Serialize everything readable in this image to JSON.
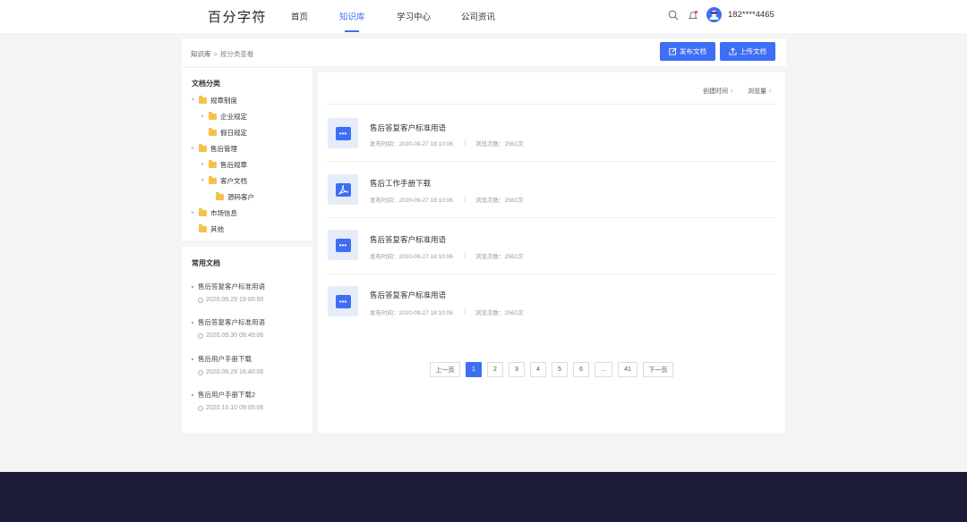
{
  "header": {
    "logo": "百分字符",
    "nav": [
      "首页",
      "知识库",
      "学习中心",
      "公司资讯"
    ],
    "phone": "182****4465"
  },
  "breadcrumb": {
    "root": "知识库",
    "sep": ">",
    "current": "按分类查看"
  },
  "actions": {
    "publish": "发布文档",
    "upload": "上传文档"
  },
  "categories": {
    "title": "文档分类",
    "items": [
      {
        "label": "规章制度"
      },
      {
        "label": "企业规定"
      },
      {
        "label": "假日规定"
      },
      {
        "label": "售后管理"
      },
      {
        "label": "售后规章"
      },
      {
        "label": "客户文档"
      },
      {
        "label": "源码客户"
      },
      {
        "label": "市场信息"
      },
      {
        "label": "其他"
      }
    ]
  },
  "common": {
    "title": "常用文档",
    "items": [
      {
        "title": "售后答复客户标准用语",
        "date": "2020.09.29 19:00:50"
      },
      {
        "title": "售后答复客户标准用语",
        "date": "2020.09.30 09:45:06"
      },
      {
        "title": "售后用户手册下载",
        "date": "2020.09.29 16:40:06"
      },
      {
        "title": "售后用户手册下载2",
        "date": "2020.10.10 09:05:06"
      }
    ]
  },
  "sort": {
    "created": "创建时间",
    "views": "浏览量"
  },
  "docs": [
    {
      "icon": "message-icon",
      "title": "售后答复客户标准用语",
      "published": "发布时间：2020-09-27 18:10:06",
      "views": "浏览次数：2562次"
    },
    {
      "icon": "pdf-icon",
      "title": "售后工作手册下载",
      "published": "发布时间：2020-09-27 18:10:06",
      "views": "浏览次数：2562次"
    },
    {
      "icon": "message-icon",
      "title": "售后答复客户标准用语",
      "published": "发布时间：2020-09-27 18:10:06",
      "views": "浏览次数：2562次"
    },
    {
      "icon": "message-icon",
      "title": "售后答复客户标准用语",
      "published": "发布时间：2020-09-27 18:10:06",
      "views": "浏览次数：2562次"
    }
  ],
  "pagination": {
    "prev": "上一页",
    "pages": [
      "1",
      "2",
      "3",
      "4",
      "5",
      "6",
      "...",
      "41"
    ],
    "next": "下一页",
    "current": "1"
  },
  "colors": {
    "accent": "#3e6ef4",
    "folder": "#f5c24a",
    "footer": "#1c1b38"
  }
}
